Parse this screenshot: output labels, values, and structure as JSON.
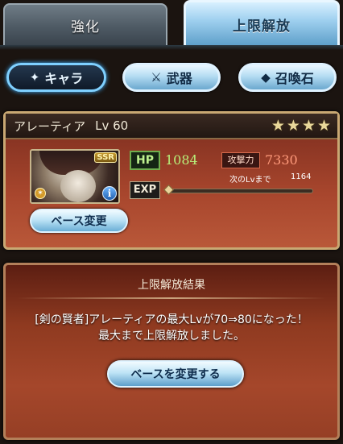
{
  "tabs": [
    {
      "label": "強化",
      "active": false
    },
    {
      "label": "上限解放",
      "active": true
    }
  ],
  "categories": [
    {
      "label": "キャラ",
      "icon": "character-crest-icon",
      "active": true
    },
    {
      "label": "武器",
      "icon": "crossed-swords-icon",
      "active": false
    },
    {
      "label": "召喚石",
      "icon": "summon-crystal-icon",
      "active": false
    }
  ],
  "character": {
    "name": "アレーティア",
    "level": "Lv 60",
    "rarity": "SSR",
    "stars": 4,
    "hp_label": "HP",
    "hp": "1084",
    "atk_label": "攻撃力",
    "atk": "7330",
    "exp_label": "EXP",
    "next_level_label": "次のLvまで",
    "next_level_exp": "1164",
    "exp_progress": 0.0,
    "base_change_label": "ベース変更"
  },
  "result": {
    "title": "上限解放結果",
    "message_line1": "[剣の賢者]アレーティアの最大Lvが70⇒80になった！",
    "message_line2": "最大まで上限解放しました。",
    "button_label": "ベースを変更する"
  },
  "colors": {
    "accent_blue": "#7fd0ff",
    "hp_green": "#b7f07a",
    "atk_red": "#ff9a7b"
  }
}
